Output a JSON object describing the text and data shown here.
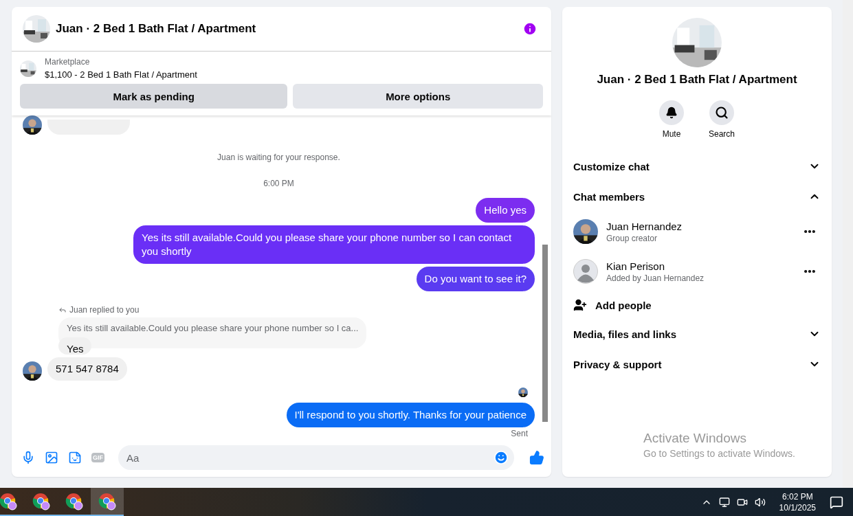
{
  "chat": {
    "title": "Juan · 2 Bed 1 Bath Flat / Apartment",
    "listing": {
      "source": "Marketplace",
      "title": "$1,100 - 2 Bed 1 Bath Flat / Apartment"
    },
    "listing_buttons": [
      {
        "label": "Mark as pending",
        "highlighted": true
      },
      {
        "label": "More options",
        "highlighted": false
      }
    ],
    "messages": [
      {
        "kind": "stub"
      },
      {
        "kind": "notice",
        "text": "Juan is waiting for your response."
      },
      {
        "kind": "time",
        "text": "6:00 PM"
      },
      {
        "kind": "outgoing",
        "text": "Hello yes",
        "color": "#7c2df0"
      },
      {
        "kind": "outgoing",
        "text": "Yes its still available.Could you please share your phone number so I can contact you shortly",
        "color": "#6a2ff6"
      },
      {
        "kind": "outgoing",
        "text": "Do you want to see it?",
        "color": "#5a3bf1"
      },
      {
        "kind": "reply",
        "label": "Juan replied to you",
        "quoted": "Yes its still available.Could you please share your phone number so I ca...",
        "text": "Yes"
      },
      {
        "kind": "incoming",
        "text": "571 547 8784"
      },
      {
        "kind": "seen"
      },
      {
        "kind": "outgoing",
        "text": "I'll respond to you shortly. Thanks for your patience",
        "color": "#0a6cf5"
      },
      {
        "kind": "status",
        "text": "Sent"
      }
    ],
    "composer": {
      "gif_label": "GIF",
      "placeholder": "Aa"
    }
  },
  "details": {
    "title": "Juan · 2 Bed 1 Bath Flat / Apartment",
    "actions": [
      {
        "kind": "mute",
        "label": "Mute"
      },
      {
        "kind": "search",
        "label": "Search"
      }
    ],
    "sections": [
      {
        "label": "Customize chat",
        "expanded": false
      },
      {
        "label": "Chat members",
        "expanded": true,
        "members": [
          {
            "name": "Juan Hernandez",
            "subtitle": "Group creator"
          },
          {
            "name": "Kian Perison",
            "subtitle": "Added by Juan Hernandez",
            "kind": "default"
          }
        ],
        "add_label": "Add people"
      },
      {
        "label": "Media, files and links",
        "expanded": false
      },
      {
        "label": "Privacy & support",
        "expanded": false
      }
    ],
    "watermark": {
      "title": "Activate Windows",
      "text": "Go to Settings to activate Windows."
    }
  },
  "taskbar": {
    "apps": [
      {
        "selected": false
      },
      {
        "selected": false
      },
      {
        "selected": false
      },
      {
        "selected": true
      }
    ],
    "time": "6:02 PM",
    "date": "10/1/2025"
  }
}
